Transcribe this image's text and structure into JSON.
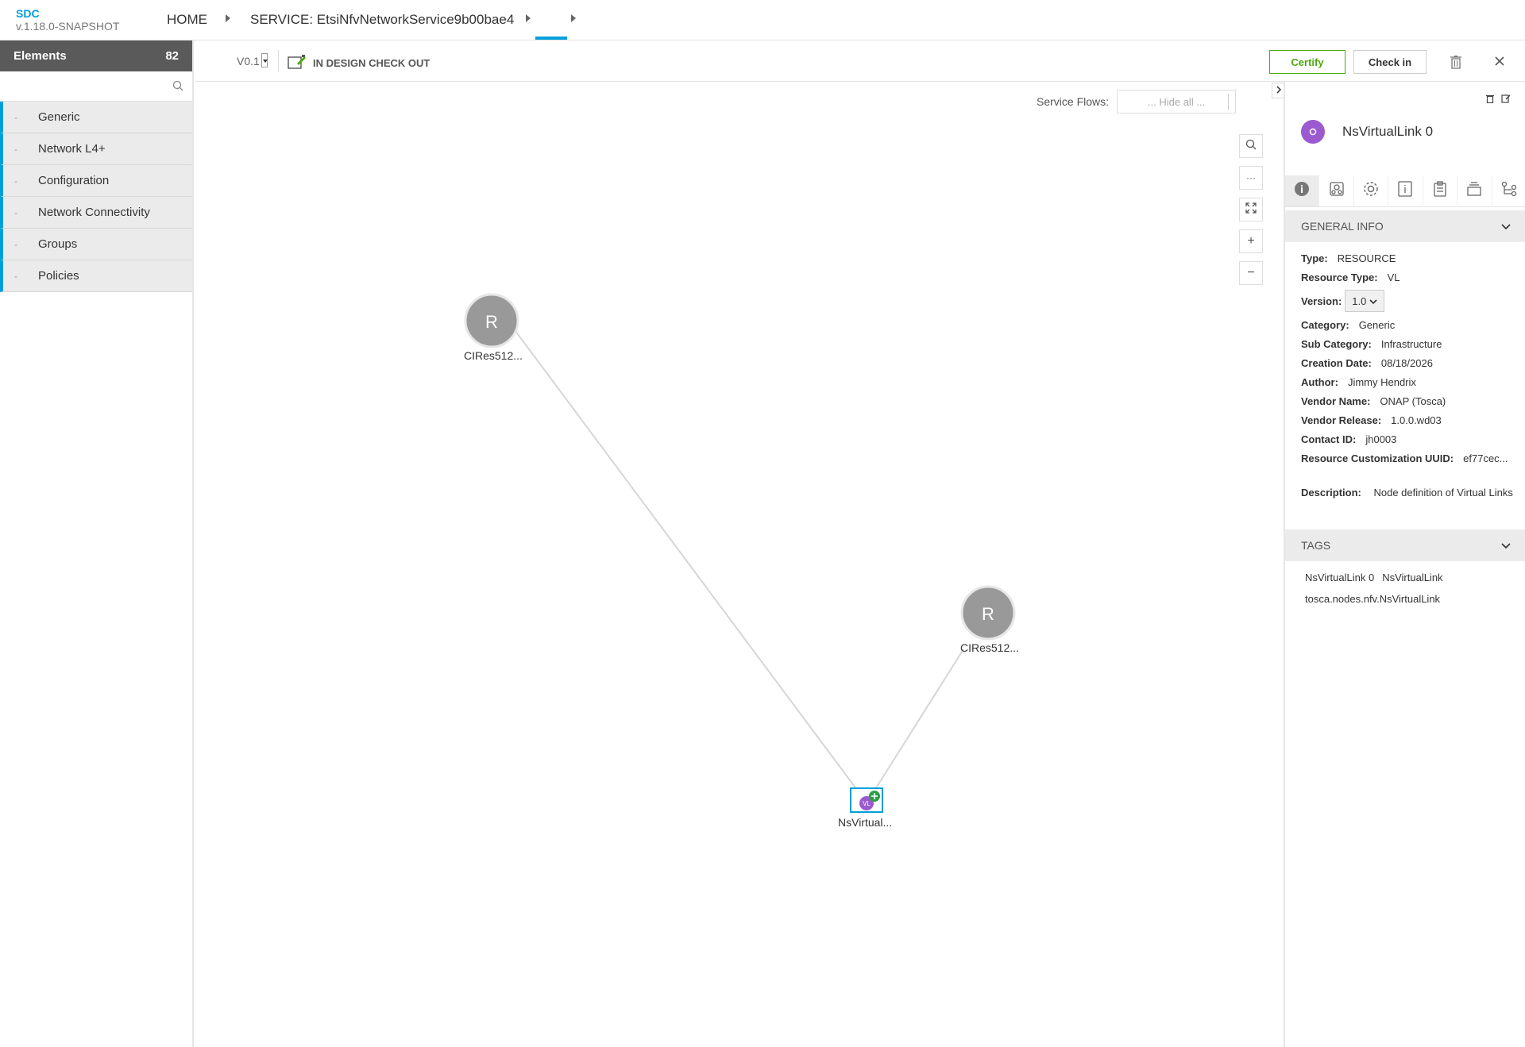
{
  "app": {
    "name": "SDC",
    "version": "v.1.18.0-SNAPSHOT"
  },
  "breadcrumb": {
    "home": "HOME",
    "service": "SERVICE: EtsiNfvNetworkService9b00bae4"
  },
  "palette": {
    "title": "Elements",
    "count": "82",
    "search_placeholder": "",
    "items": [
      {
        "label": "Generic"
      },
      {
        "label": "Network L4+"
      },
      {
        "label": "Configuration"
      },
      {
        "label": "Network Connectivity"
      },
      {
        "label": "Groups"
      },
      {
        "label": "Policies"
      }
    ]
  },
  "toolbar": {
    "version": "V0.1",
    "status": "IN DESIGN CHECK OUT",
    "certify_label": "Certify",
    "checkin_label": "Check in"
  },
  "canvas": {
    "service_flows_label": "Service Flows:",
    "service_flows_value": "... Hide all ...",
    "nodes": [
      {
        "letter": "R",
        "label": "CIRes512..."
      },
      {
        "letter": "R",
        "label": "CIRes512..."
      },
      {
        "letter": "VL",
        "label": "NsVirtual..."
      }
    ]
  },
  "panel": {
    "name": "NsVirtualLink 0",
    "general_info_title": "GENERAL INFO",
    "fields": {
      "type_k": "Type:",
      "type_v": "RESOURCE",
      "rtype_k": "Resource Type:",
      "rtype_v": "VL",
      "version_k": "Version:",
      "version_v": "1.0",
      "category_k": "Category:",
      "category_v": "Generic",
      "subcat_k": "Sub Category:",
      "subcat_v": "Infrastructure",
      "cdate_k": "Creation Date:",
      "cdate_v": "08/18/2026",
      "author_k": "Author:",
      "author_v": "Jimmy Hendrix",
      "vendor_k": "Vendor Name:",
      "vendor_v": "ONAP (Tosca)",
      "vrel_k": "Vendor Release:",
      "vrel_v": "1.0.0.wd03",
      "contact_k": "Contact ID:",
      "contact_v": "jh0003",
      "uuid_k": "Resource Customization UUID:",
      "uuid_v": "ef77cec...",
      "desc_k": "Description:",
      "desc_v": "Node definition of Virtual Links"
    },
    "tags_title": "TAGS",
    "tags": [
      "NsVirtualLink 0",
      "NsVirtualLink",
      "tosca.nodes.nfv.NsVirtualLink"
    ]
  },
  "colors": {
    "accent": "#009fdb",
    "certify": "#4ca90c",
    "vl_node": "#9c5ad0",
    "r_node": "#999999"
  }
}
